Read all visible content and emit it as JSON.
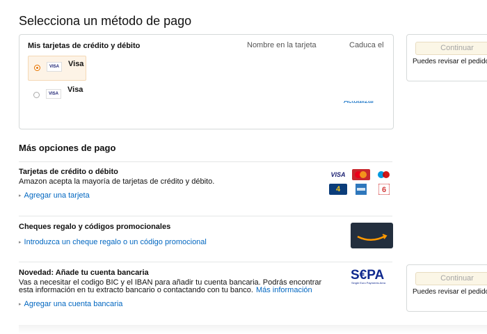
{
  "page": {
    "title": "Selecciona un método de pago"
  },
  "cards": {
    "header_title": "Mis tarjetas de crédito y débito",
    "header_name": "Nombre en la tarjeta",
    "header_expiry": "Caduca el",
    "rows": [
      {
        "brand": "VISA",
        "name": "Visa",
        "selected": true
      },
      {
        "brand": "VISA",
        "name": "Visa",
        "selected": false
      }
    ],
    "update_link": "Actualizar"
  },
  "sidebar": {
    "continue_label": "Continuar",
    "note": "Puedes revisar el pedido antes de finalizarlo"
  },
  "more_options": {
    "title": "Más opciones de pago",
    "credit": {
      "title": "Tarjetas de crédito o débito",
      "desc": "Amazon acepta la mayoría de tarjetas de crédito y débito.",
      "link": "Agregar una tarjeta",
      "logos": [
        "VISA",
        "MasterCard",
        "Maestro",
        "4B",
        "American Express",
        "6000"
      ]
    },
    "gift": {
      "title": "Cheques regalo y códigos promocionales",
      "link": "Introduzca un cheque regalo o un código promocional"
    },
    "bank": {
      "title": "Novedad: Añade tu cuenta bancaria",
      "desc_line1": "Vas a necesitar el codigo BIC y el IBAN para añadir tu cuenta bancaria. Podrás encontrar",
      "desc_line2": "esta información en tu extracto bancario o contactando con tu banco.",
      "more_info": "Más información",
      "link": "Agregar una cuenta bancaria",
      "sepa_logo": "S€PA",
      "sepa_tagline": "Single Euro Payments Area"
    }
  },
  "colors": {
    "link": "#0066c0",
    "selected_bg": "#fdf3e6",
    "radio_on": "#e77600",
    "amazon_card": "#232f3e",
    "amazon_smile": "#ff9900",
    "sepa_blue": "#10298e"
  }
}
